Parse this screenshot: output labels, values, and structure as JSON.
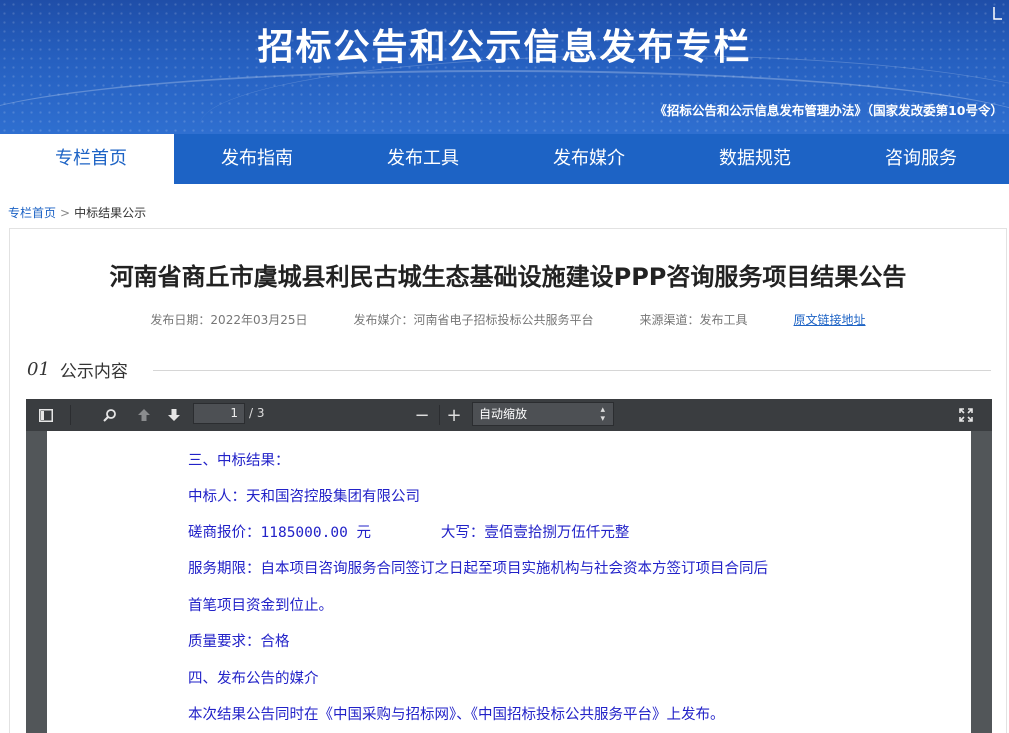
{
  "banner": {
    "title": "招标公告和公示信息发布专栏",
    "subtitle": "《招标公告和公示信息发布管理办法》（国家发改委第10号令）"
  },
  "nav": {
    "items": [
      "专栏首页",
      "发布指南",
      "发布工具",
      "发布媒介",
      "数据规范",
      "咨询服务"
    ],
    "active_index": 0
  },
  "breadcrumb": {
    "home": "专栏首页",
    "separator": ">",
    "current": "中标结果公示"
  },
  "article": {
    "title": "河南省商丘市虞城县利民古城生态基础设施建设PPP咨询服务项目结果公告",
    "publish_date": "发布日期：2022年03月25日",
    "publish_media": "发布媒介：河南省电子招标投标公共服务平台",
    "source_channel": "来源渠道：发布工具",
    "original_link": "原文链接地址"
  },
  "section": {
    "number": "01",
    "label": "公示内容"
  },
  "viewer": {
    "page_current": "1",
    "page_total": "/ 3",
    "zoom": "自动缩放",
    "icons": [
      "sidebar-toggle-icon",
      "search-icon",
      "previous-page-icon",
      "next-page-icon",
      "zoom-out-icon",
      "zoom-in-icon",
      "presentation-mode-icon"
    ],
    "zoom_out_label": "−",
    "zoom_in_label": "+"
  },
  "pdf_lines": [
    "三、中标结果：",
    "中标人：天和国咨控股集团有限公司",
    "磋商报价：1185000.00 元        大写：壹佰壹拾捌万伍仟元整",
    "服务期限：自本项目咨询服务合同签订之日起至项目实施机构与社会资本方签订项目合同后",
    "首笔项目资金到位止。",
    "质量要求：合格",
    "四、发布公告的媒介",
    "本次结果公告同时在《中国采购与招标网》、《中国招标投标公共服务平台》上发布。"
  ],
  "colors": {
    "brand_blue": "#1d63c5",
    "pdf_text": "#2222c8",
    "toolbar": "#3a3d40"
  }
}
